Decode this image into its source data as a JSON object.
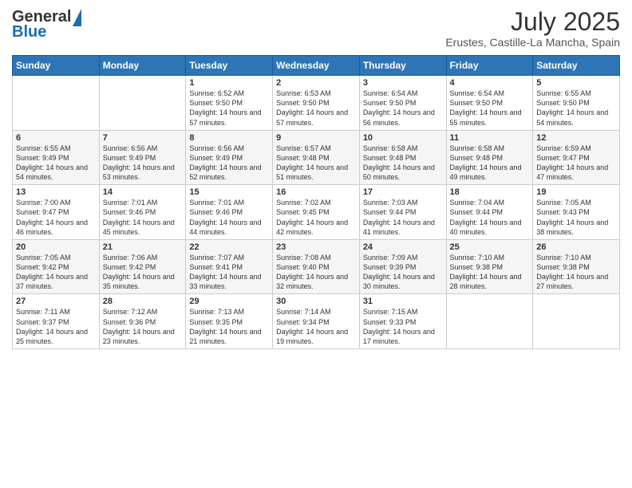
{
  "header": {
    "logo_line1": "General",
    "logo_line2": "Blue",
    "title": "July 2025",
    "subtitle": "Erustes, Castille-La Mancha, Spain"
  },
  "calendar": {
    "days_of_week": [
      "Sunday",
      "Monday",
      "Tuesday",
      "Wednesday",
      "Thursday",
      "Friday",
      "Saturday"
    ],
    "weeks": [
      [
        {
          "day": "",
          "sunrise": "",
          "sunset": "",
          "daylight": ""
        },
        {
          "day": "",
          "sunrise": "",
          "sunset": "",
          "daylight": ""
        },
        {
          "day": "1",
          "sunrise": "Sunrise: 6:52 AM",
          "sunset": "Sunset: 9:50 PM",
          "daylight": "Daylight: 14 hours and 57 minutes."
        },
        {
          "day": "2",
          "sunrise": "Sunrise: 6:53 AM",
          "sunset": "Sunset: 9:50 PM",
          "daylight": "Daylight: 14 hours and 57 minutes."
        },
        {
          "day": "3",
          "sunrise": "Sunrise: 6:54 AM",
          "sunset": "Sunset: 9:50 PM",
          "daylight": "Daylight: 14 hours and 56 minutes."
        },
        {
          "day": "4",
          "sunrise": "Sunrise: 6:54 AM",
          "sunset": "Sunset: 9:50 PM",
          "daylight": "Daylight: 14 hours and 55 minutes."
        },
        {
          "day": "5",
          "sunrise": "Sunrise: 6:55 AM",
          "sunset": "Sunset: 9:50 PM",
          "daylight": "Daylight: 14 hours and 54 minutes."
        }
      ],
      [
        {
          "day": "6",
          "sunrise": "Sunrise: 6:55 AM",
          "sunset": "Sunset: 9:49 PM",
          "daylight": "Daylight: 14 hours and 54 minutes."
        },
        {
          "day": "7",
          "sunrise": "Sunrise: 6:56 AM",
          "sunset": "Sunset: 9:49 PM",
          "daylight": "Daylight: 14 hours and 53 minutes."
        },
        {
          "day": "8",
          "sunrise": "Sunrise: 6:56 AM",
          "sunset": "Sunset: 9:49 PM",
          "daylight": "Daylight: 14 hours and 52 minutes."
        },
        {
          "day": "9",
          "sunrise": "Sunrise: 6:57 AM",
          "sunset": "Sunset: 9:48 PM",
          "daylight": "Daylight: 14 hours and 51 minutes."
        },
        {
          "day": "10",
          "sunrise": "Sunrise: 6:58 AM",
          "sunset": "Sunset: 9:48 PM",
          "daylight": "Daylight: 14 hours and 50 minutes."
        },
        {
          "day": "11",
          "sunrise": "Sunrise: 6:58 AM",
          "sunset": "Sunset: 9:48 PM",
          "daylight": "Daylight: 14 hours and 49 minutes."
        },
        {
          "day": "12",
          "sunrise": "Sunrise: 6:59 AM",
          "sunset": "Sunset: 9:47 PM",
          "daylight": "Daylight: 14 hours and 47 minutes."
        }
      ],
      [
        {
          "day": "13",
          "sunrise": "Sunrise: 7:00 AM",
          "sunset": "Sunset: 9:47 PM",
          "daylight": "Daylight: 14 hours and 46 minutes."
        },
        {
          "day": "14",
          "sunrise": "Sunrise: 7:01 AM",
          "sunset": "Sunset: 9:46 PM",
          "daylight": "Daylight: 14 hours and 45 minutes."
        },
        {
          "day": "15",
          "sunrise": "Sunrise: 7:01 AM",
          "sunset": "Sunset: 9:46 PM",
          "daylight": "Daylight: 14 hours and 44 minutes."
        },
        {
          "day": "16",
          "sunrise": "Sunrise: 7:02 AM",
          "sunset": "Sunset: 9:45 PM",
          "daylight": "Daylight: 14 hours and 42 minutes."
        },
        {
          "day": "17",
          "sunrise": "Sunrise: 7:03 AM",
          "sunset": "Sunset: 9:44 PM",
          "daylight": "Daylight: 14 hours and 41 minutes."
        },
        {
          "day": "18",
          "sunrise": "Sunrise: 7:04 AM",
          "sunset": "Sunset: 9:44 PM",
          "daylight": "Daylight: 14 hours and 40 minutes."
        },
        {
          "day": "19",
          "sunrise": "Sunrise: 7:05 AM",
          "sunset": "Sunset: 9:43 PM",
          "daylight": "Daylight: 14 hours and 38 minutes."
        }
      ],
      [
        {
          "day": "20",
          "sunrise": "Sunrise: 7:05 AM",
          "sunset": "Sunset: 9:42 PM",
          "daylight": "Daylight: 14 hours and 37 minutes."
        },
        {
          "day": "21",
          "sunrise": "Sunrise: 7:06 AM",
          "sunset": "Sunset: 9:42 PM",
          "daylight": "Daylight: 14 hours and 35 minutes."
        },
        {
          "day": "22",
          "sunrise": "Sunrise: 7:07 AM",
          "sunset": "Sunset: 9:41 PM",
          "daylight": "Daylight: 14 hours and 33 minutes."
        },
        {
          "day": "23",
          "sunrise": "Sunrise: 7:08 AM",
          "sunset": "Sunset: 9:40 PM",
          "daylight": "Daylight: 14 hours and 32 minutes."
        },
        {
          "day": "24",
          "sunrise": "Sunrise: 7:09 AM",
          "sunset": "Sunset: 9:39 PM",
          "daylight": "Daylight: 14 hours and 30 minutes."
        },
        {
          "day": "25",
          "sunrise": "Sunrise: 7:10 AM",
          "sunset": "Sunset: 9:38 PM",
          "daylight": "Daylight: 14 hours and 28 minutes."
        },
        {
          "day": "26",
          "sunrise": "Sunrise: 7:10 AM",
          "sunset": "Sunset: 9:38 PM",
          "daylight": "Daylight: 14 hours and 27 minutes."
        }
      ],
      [
        {
          "day": "27",
          "sunrise": "Sunrise: 7:11 AM",
          "sunset": "Sunset: 9:37 PM",
          "daylight": "Daylight: 14 hours and 25 minutes."
        },
        {
          "day": "28",
          "sunrise": "Sunrise: 7:12 AM",
          "sunset": "Sunset: 9:36 PM",
          "daylight": "Daylight: 14 hours and 23 minutes."
        },
        {
          "day": "29",
          "sunrise": "Sunrise: 7:13 AM",
          "sunset": "Sunset: 9:35 PM",
          "daylight": "Daylight: 14 hours and 21 minutes."
        },
        {
          "day": "30",
          "sunrise": "Sunrise: 7:14 AM",
          "sunset": "Sunset: 9:34 PM",
          "daylight": "Daylight: 14 hours and 19 minutes."
        },
        {
          "day": "31",
          "sunrise": "Sunrise: 7:15 AM",
          "sunset": "Sunset: 9:33 PM",
          "daylight": "Daylight: 14 hours and 17 minutes."
        },
        {
          "day": "",
          "sunrise": "",
          "sunset": "",
          "daylight": ""
        },
        {
          "day": "",
          "sunrise": "",
          "sunset": "",
          "daylight": ""
        }
      ]
    ]
  }
}
